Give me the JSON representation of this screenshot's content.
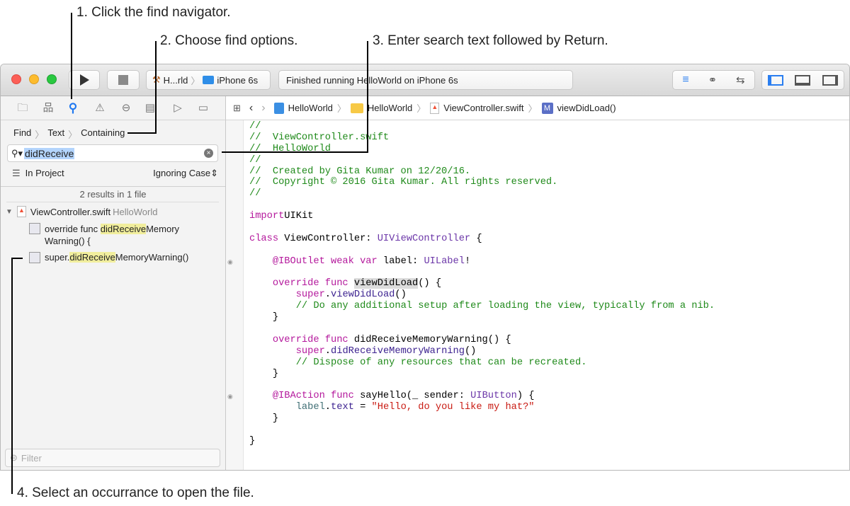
{
  "annotations": [
    "1. Click the find navigator.",
    "2. Choose find options.",
    "3. Enter search text followed by Return.",
    "4. Select an occurrance to open the file."
  ],
  "toolbar": {
    "scheme": "H...rld",
    "device": "iPhone 6s",
    "status": "Finished running HelloWorld on iPhone 6s"
  },
  "jump_bar": [
    "HelloWorld",
    "HelloWorld",
    "ViewController.swift",
    "viewDidLoad()"
  ],
  "find": {
    "breadcrumb": [
      "Find",
      "Text",
      "Containing"
    ],
    "query": "didReceive",
    "scope": "In Project",
    "case": "Ignoring Case",
    "summary": "2 results in 1 file",
    "filter_placeholder": "Filter"
  },
  "results": {
    "file": "ViewController.swift",
    "project": "HelloWorld",
    "matches": [
      {
        "pre": "override func ",
        "hit": "didReceive",
        "post": "Memory",
        "line2": "Warning() {"
      },
      {
        "pre": "super.",
        "hit": "didReceive",
        "post": "MemoryWarning()",
        "line2": ""
      }
    ]
  },
  "code": [
    [
      [
        "cm",
        "//"
      ]
    ],
    [
      [
        "cm",
        "//  ViewController.swift"
      ]
    ],
    [
      [
        "cm",
        "//  HelloWorld"
      ]
    ],
    [
      [
        "cm",
        "//"
      ]
    ],
    [
      [
        "cm",
        "//  Created by Gita Kumar on 12/20/16."
      ]
    ],
    [
      [
        "cm",
        "//  Copyright © 2016 Gita Kumar. All rights reserved."
      ]
    ],
    [
      [
        "cm",
        "//"
      ]
    ],
    [],
    [
      [
        "kw",
        "import"
      ],
      [
        "",
        "UIKit"
      ]
    ],
    [],
    [
      [
        "kw",
        "class"
      ],
      [
        "",
        " ViewController: "
      ],
      [
        "ty",
        "UIViewController"
      ],
      [
        "",
        " {"
      ]
    ],
    [],
    [
      [
        "",
        "    "
      ],
      [
        "kw",
        "@IBOutlet weak var"
      ],
      [
        "",
        " label: "
      ],
      [
        "ty",
        "UILabel"
      ],
      [
        "",
        "!"
      ]
    ],
    [],
    [
      [
        "",
        "    "
      ],
      [
        "kw",
        "override func"
      ],
      [
        "",
        " "
      ],
      [
        "sel",
        "viewDidLoad"
      ],
      [
        "",
        "() {"
      ]
    ],
    [
      [
        "",
        "        "
      ],
      [
        "kw",
        "super"
      ],
      [
        "",
        "."
      ],
      [
        "fn",
        "viewDidLoad"
      ],
      [
        "",
        "()"
      ]
    ],
    [
      [
        "",
        "        "
      ],
      [
        "cm",
        "// Do any additional setup after loading the view, typically from a nib."
      ]
    ],
    [
      [
        "",
        "    }"
      ]
    ],
    [],
    [
      [
        "",
        "    "
      ],
      [
        "kw",
        "override func"
      ],
      [
        "",
        " didReceiveMemoryWarning() {"
      ]
    ],
    [
      [
        "",
        "        "
      ],
      [
        "kw",
        "super"
      ],
      [
        "",
        "."
      ],
      [
        "fn",
        "didReceiveMemoryWarning"
      ],
      [
        "",
        "()"
      ]
    ],
    [
      [
        "",
        "        "
      ],
      [
        "cm",
        "// Dispose of any resources that can be recreated."
      ]
    ],
    [
      [
        "",
        "    }"
      ]
    ],
    [],
    [
      [
        "",
        "    "
      ],
      [
        "kw",
        "@IBAction func"
      ],
      [
        "",
        " sayHello(_ sender: "
      ],
      [
        "ty",
        "UIButton"
      ],
      [
        "",
        ") {"
      ]
    ],
    [
      [
        "",
        "        "
      ],
      [
        "pv",
        "label"
      ],
      [
        "",
        "."
      ],
      [
        "fn",
        "text"
      ],
      [
        "",
        " = "
      ],
      [
        "st",
        "\"Hello, do you like my hat?\""
      ]
    ],
    [
      [
        "",
        "    }"
      ]
    ],
    [],
    [
      [
        "",
        "}"
      ]
    ]
  ]
}
